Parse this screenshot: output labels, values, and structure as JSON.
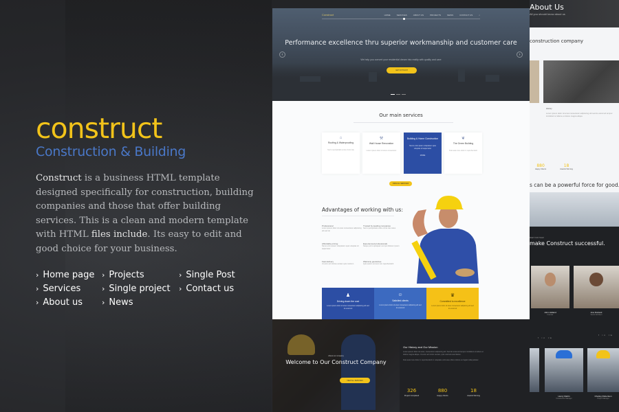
{
  "promo": {
    "brand": "construct",
    "tagline": "Construction & Building",
    "description": {
      "lead": "Construct",
      "part1": " is a business HTML template designed specifically for construction, building companies and those that offer building services. This is a clean and modern template with HTML ",
      "emph": "files include",
      "part2": ". Its easy to edit and good choice for your business."
    },
    "links": [
      "Home page",
      "Projects",
      "Single Post",
      "Services",
      "Single project",
      "Contact us",
      "About us",
      "News"
    ]
  },
  "mockup": {
    "nav": {
      "logo": "Construct",
      "items": [
        "HOME",
        "SERVICES",
        "ABOUT US",
        "PROJECTS",
        "NEWS",
        "CONTACT US"
      ]
    },
    "hero": {
      "title": "Performance excellence thru superior workmanship and customer care",
      "subtitle": "We help you convert your residential dream into reality with quality and care",
      "cta": "GET IN TOUCH"
    },
    "services": {
      "title": "Our main services",
      "items": [
        {
          "title": "Roofing & Waterproofing",
          "desc": "Sed ut perspiciatis unde omnis iste"
        },
        {
          "title": "Wall House Renovation",
          "desc": "Lorem ipsum dolor sit amet consectetur"
        },
        {
          "title": "Building & Home Construction",
          "desc": "Nemo enim ipsam voluptatem quia voluptas sit aspernatur",
          "more": "MORE"
        },
        {
          "title": "The Green Building",
          "desc": "Duis aute irure dolor in reprehenderit"
        }
      ],
      "button": "VIEW ALL SERVICES"
    },
    "advantages": {
      "title": "Advantages of working with us:",
      "items": [
        {
          "h": "Professional",
          "d": "Lorem ipsum dolor sit amet consectetur adipiscing elit sed do"
        },
        {
          "h": "Trusted by leading companies",
          "d": "Sed ut perspiciatis unde omnis iste natus"
        },
        {
          "h": "Affordable pricing",
          "d": "Nemo enim ipsam voluptatem quia voluptas sit aspernatur"
        },
        {
          "h": "Experienced professionals",
          "d": "Neque porro quisquam est qui dolorem ipsum"
        },
        {
          "h": "Fast delivery",
          "d": "Ut enim ad minima veniam quis nostrum"
        },
        {
          "h": "Warranty guarantee",
          "d": "Quis autem vel eum iure reprehenderit"
        }
      ]
    },
    "features": [
      {
        "title": "Driving down the cost",
        "desc": "Lorem ipsum dolor sit amet consectetur adipiscing elit sed do eiusmod",
        "color": "#2c4ea4"
      },
      {
        "title": "Satisfied clients",
        "desc": "Lorem ipsum dolor sit amet consectetur adipiscing elit sed do eiusmod",
        "color": "#3c6ac0"
      },
      {
        "title": "Committed to excellence",
        "desc": "Lorem ipsum dolor sit amet consectetur adipiscing elit sed do eiusmod",
        "color": "#f5c117"
      }
    ],
    "welcome": {
      "kicker": "About our company",
      "title": "Welcome to Our Construct Company",
      "button": "VIEW ALL SERVICES"
    },
    "history": {
      "title": "Our History and Our Mission",
      "p1": "Lorem ipsum dolor sit amet, consectetur adipiscing elit. Sed do eiusmod tempor incididunt ut labore et dolore magna aliqua. Ut enim ad minim veniam, quis nostrud exercitation.",
      "p2": "Duis aute irure dolor in reprehenderit in voluptate velit esse cillum dolore eu fugiat nulla pariatur."
    },
    "stats": [
      {
        "value": "326",
        "label": "Project Completed"
      },
      {
        "value": "880",
        "label": "Happy Clients"
      },
      {
        "value": "18",
        "label": "Awards Winning"
      }
    ]
  },
  "right": {
    "about_title": "About Us",
    "about_sub": "All you should know about us",
    "heading": "construction company",
    "history_title": "History",
    "history_text": "Lorem ipsum dolor sit amet consectetur adipiscing elit sed do eiusmod tempor incididunt ut labore et dolore magna aliqua",
    "stats": [
      {
        "value": "880",
        "label": "Happy Clients"
      },
      {
        "value": "18",
        "label": "Awards Winning"
      }
    ],
    "quote": "s can be a powerful force for good.",
    "team_kicker": "MEET OUR TEAM",
    "team_heading": "make Construct successful.",
    "team": [
      {
        "name": "John Holland",
        "role": "Founder"
      },
      {
        "name": "Ana Dorland",
        "role": "Senior Architect"
      },
      {
        "name": "Henry Martin",
        "role": "Construction Manager"
      },
      {
        "name": "Charley Robertson",
        "role": "Project Manager"
      }
    ],
    "social": "f  in  tw"
  }
}
